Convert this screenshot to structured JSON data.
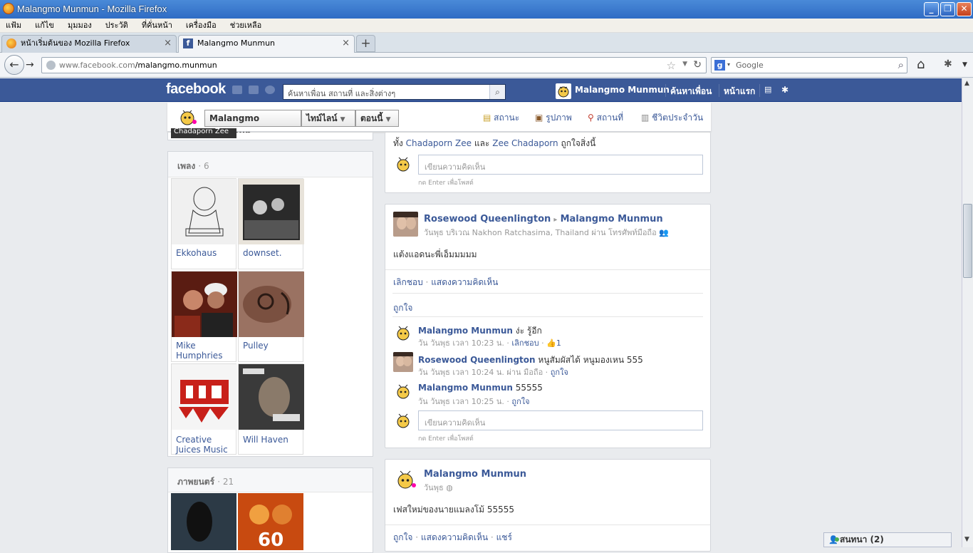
{
  "window": {
    "title": "Malangmo Munmun - Mozilla Firefox"
  },
  "menu": [
    "แฟ้ม",
    "แก้ไข",
    "มุมมอง",
    "ประวัติ",
    "ที่คั่นหน้า",
    "เครื่องมือ",
    "ช่วยเหลือ"
  ],
  "tabs": [
    {
      "label": "หน้าเริ่มต้นของ Mozilla Firefox",
      "active": false
    },
    {
      "label": "Malangmo Munmun",
      "active": true
    }
  ],
  "newtab_label": "+",
  "url": {
    "prefix": "www.facebook.com",
    "path": "/malangmo.munmun"
  },
  "search": {
    "engine_letter": "g",
    "placeholder": "Google"
  },
  "fb": {
    "logo": "facebook",
    "search_placeholder": "ค้นหาเพื่อน สถานที่ และสิ่งต่างๆ",
    "user": "Malangmo Munmun",
    "find_friends": "ค้นหาเพื่อน",
    "home": "หน้าแรก"
  },
  "timeline_header": {
    "name": "Malangmo Munmun",
    "timeline": "ไทม์ไลน์",
    "now": "ตอนนี้",
    "status": "สถานะ",
    "photo": "รูปภาพ",
    "place": "สถานที่",
    "life_event": "ชีวิตประจำวัน"
  },
  "top_cut_label": "Chadaporn Zee",
  "music": {
    "title": "เพลง",
    "count": "· 6",
    "items": [
      {
        "label": "Ekkohaus",
        "bg": "#e8e8e8"
      },
      {
        "label": "downset.",
        "bg": "#2a2a2a"
      },
      {
        "label": "Mike Humphries",
        "bg": "#6a1810"
      },
      {
        "label": "Pulley",
        "bg": "#8a6050"
      },
      {
        "label": "Creative Juices Music",
        "bg": "#f3f3f3"
      },
      {
        "label": "Will Haven",
        "bg": "#4a4a4a"
      }
    ]
  },
  "movies": {
    "title": "ภาพยนตร์",
    "count": "· 21"
  },
  "post0": {
    "likes_text_pre": "ทั้ง",
    "liker1": "Chadaporn Zee",
    "and": "และ",
    "liker2": "Zee Chadaporn",
    "likes_text_post": "ถูกใจสิ่งนี้",
    "comment_placeholder": "เขียนความคิดเห็น",
    "enter_hint": "กด Enter เพื่อโพสต์"
  },
  "post1": {
    "author": "Rosewood Queenlington",
    "arrow": "▸",
    "target": "Malangmo Munmun",
    "meta": "วันพุธ บริเวณ Nakhon Ratchasima, Thailand ผ่าน โทรศัพท์มือถือ",
    "body": "แต้งแอดนะพี่เอ็มมมมม",
    "unlike": "เลิกชอบ",
    "comment": "แสดงความคิดเห็น",
    "like_label": "ถูกใจ",
    "comments": [
      {
        "author": "Malangmo Munmun",
        "text": "ง่ะ รู้อีก",
        "meta": "วัน วันพุธ เวลา 10:23 น.",
        "action": "เลิกชอบ",
        "likes": "1"
      },
      {
        "author": "Rosewood Queenlington",
        "text": "หนูสัมผัสได้ หนูมองเหน 555",
        "meta": "วัน วันพุธ เวลา 10:24 น. ผ่าน มือถือ",
        "action": "ถูกใจ",
        "likes": ""
      },
      {
        "author": "Malangmo Munmun",
        "text": "55555",
        "meta": "วัน วันพุธ เวลา 10:25 น.",
        "action": "ถูกใจ",
        "likes": ""
      }
    ],
    "comment_placeholder": "เขียนความคิดเห็น",
    "enter_hint": "กด Enter เพื่อโพสต์"
  },
  "post2": {
    "author": "Malangmo Munmun",
    "meta": "วันพุธ",
    "body": "เฟสใหม่ของนายแมลงโม้ 55555",
    "like": "ถูกใจ",
    "comment": "แสดงความคิดเห็น",
    "share": "แชร์"
  },
  "chat": {
    "label": "สนทนา (2)"
  }
}
